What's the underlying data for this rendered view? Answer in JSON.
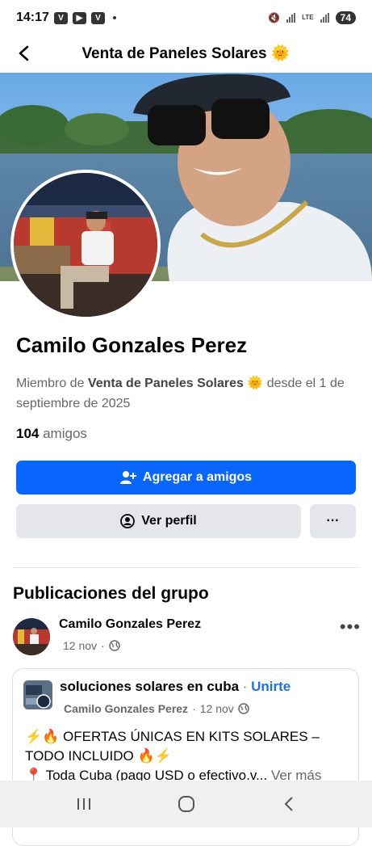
{
  "status": {
    "time": "14:17",
    "battery": "74",
    "network": "LTE"
  },
  "header": {
    "title": "Venta de Paneles Solares 🌞"
  },
  "profile": {
    "name": "Camilo Gonzales Perez",
    "member_prefix": "Miembro de ",
    "member_group": "Venta de Paneles Solares 🌞",
    "member_suffix": " desde el 1 de septiembre de 2025",
    "friends_count": "104",
    "friends_label": " amigos"
  },
  "actions": {
    "add_friend": "Agregar a amigos",
    "view_profile": "Ver perfil",
    "more": "···"
  },
  "section": {
    "title": "Publicaciones del grupo"
  },
  "post": {
    "author": "Camilo Gonzales Perez",
    "date": "12 nov",
    "dot": "·",
    "more": "•••",
    "shared": {
      "group": "soluciones solares en cuba",
      "sep": " · ",
      "join": "Unirte",
      "author": "Camilo Gonzales Perez",
      "date": "12 nov",
      "dot": "·",
      "line1": "⚡🔥 OFERTAS ÚNICAS EN KITS SOLARES – TODO INCLUIDO 🔥⚡",
      "line2": "📍 Toda Cuba (pago USD o efectivo.v...",
      "see_more": " Ver más"
    }
  },
  "colors": {
    "primary": "#0866ff",
    "gray_button": "#e4e6eb",
    "link": "#1b74e4"
  }
}
